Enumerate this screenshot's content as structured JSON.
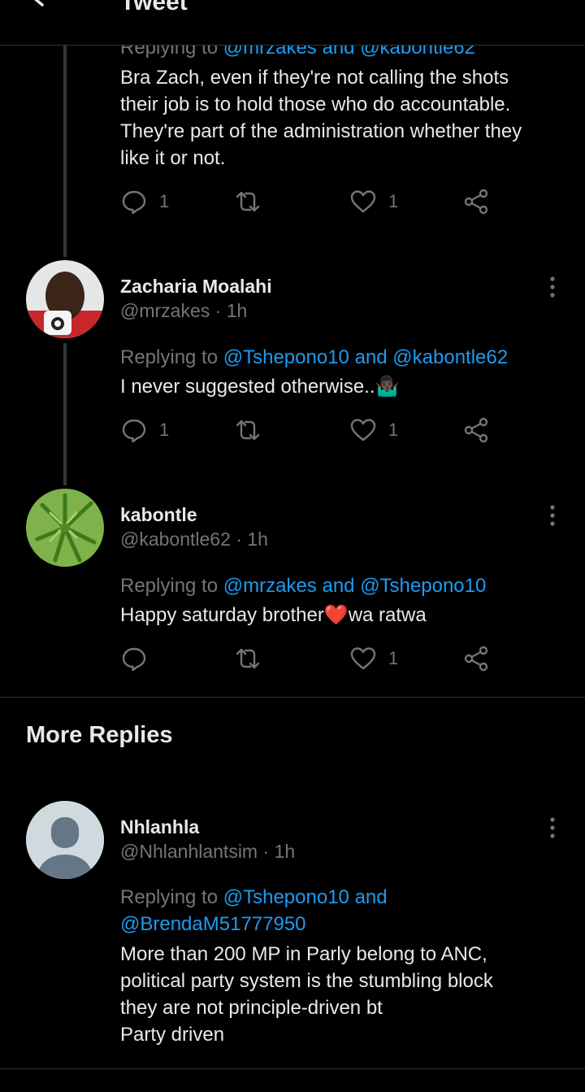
{
  "header": {
    "title": "Tweet",
    "back_icon": "arrow-left-icon"
  },
  "tweets": [
    {
      "replying_prefix": "Replying to ",
      "mention1": "@mrzakes",
      "and": " and ",
      "mention2": "@kabontle62",
      "text_lines": [
        "Bra Zach, even if they're not calling the shots",
        "their job is to hold those who do accountable.",
        "They're part of the administration whether they",
        "like it or not."
      ],
      "reply_count": "1",
      "retweet_count": "",
      "like_count": "1"
    },
    {
      "name": "Zacharia Moalahi",
      "handle": "@mrzakes",
      "time": " · 1h",
      "replying_prefix": "Replying to ",
      "mention1": "@Tshepono10",
      "and": " and ",
      "mention2": "@kabontle62",
      "text": "I never suggested otherwise..",
      "emoji": "🤷🏿‍♂️",
      "reply_count": "1",
      "retweet_count": "",
      "like_count": "1"
    },
    {
      "name": "kabontle",
      "handle": "@kabontle62",
      "time": " · 1h",
      "replying_prefix": "Replying to ",
      "mention1": "@mrzakes",
      "and": " and ",
      "mention2": "@Tshepono10",
      "text_before": "Happy saturday brother",
      "emoji": "❤️",
      "text_after": "wa ratwa",
      "reply_count": "",
      "retweet_count": "",
      "like_count": "1"
    }
  ],
  "more_replies": {
    "title": "More Replies",
    "tweet": {
      "name": "Nhlanhla",
      "handle": "@Nhlanhlantsim",
      "time": " · 1h",
      "replying_prefix": "Replying to ",
      "mention1": "@Tshepono10",
      "and": " and",
      "mention2": "@BrendaM51777950",
      "text_lines": [
        "More than 200 MP in Parly belong to ANC,",
        "political party system is the stumbling block",
        "they are not principle-driven bt",
        "Party driven"
      ]
    }
  },
  "colors": {
    "background": "#000000",
    "text": "#e7e9ea",
    "muted": "#71767b",
    "accent": "#1d9bf0",
    "divider": "#2f3336"
  }
}
